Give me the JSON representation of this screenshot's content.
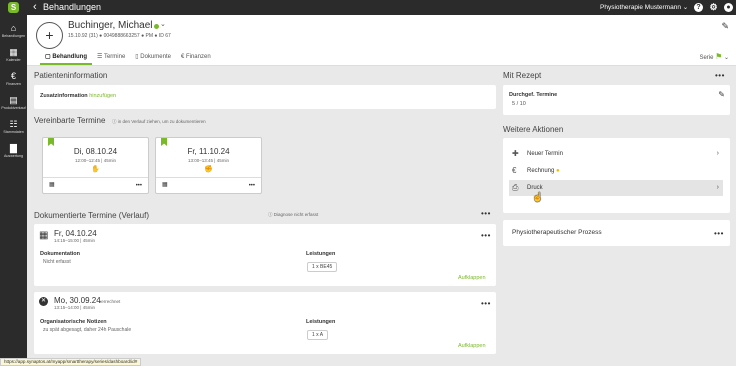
{
  "topbar": {
    "title": "Behandlungen",
    "practice": "Physiotherapie Mustermann",
    "help_icon": "help-icon",
    "settings_icon": "gear-icon",
    "user_icon": "user-icon"
  },
  "sidebar": {
    "items": [
      {
        "label": "Behandlungen",
        "icon": "home-icon"
      },
      {
        "label": "Kalender",
        "icon": "calendar-icon"
      },
      {
        "label": "Finanzen",
        "icon": "euro-icon"
      },
      {
        "label": "Produktverkauf",
        "icon": "product-icon"
      },
      {
        "label": "Stammdaten",
        "icon": "hierarchy-icon"
      },
      {
        "label": "Auswertung",
        "icon": "chart-icon"
      }
    ]
  },
  "patient": {
    "name": "Buchinger, Michael",
    "birth": "15.10.92 (31)",
    "phone": "0049888663257",
    "type": "PM",
    "id": "ID 67",
    "status_color": "#7ab929"
  },
  "tabs": [
    {
      "label": "Behandlung",
      "active": true
    },
    {
      "label": "Termine",
      "active": false
    },
    {
      "label": "Dokumente",
      "active": false
    },
    {
      "label": "Finanzen",
      "active": false
    }
  ],
  "serie_label": "Serie",
  "patient_info": {
    "title": "Patienteninformation",
    "zusatz_label": "Zusatzinformation",
    "zusatz_link": "hinzufügen"
  },
  "agreed": {
    "title": "Vereinbarte Termine",
    "hint": "in den Verlauf ziehen, um zu dokumentieren",
    "appointments": [
      {
        "date": "Di, 08.10.24",
        "time": "12:00–12:45 | 45min"
      },
      {
        "date": "Fr, 11.10.24",
        "time": "13:00–13:45 | 45min"
      }
    ]
  },
  "documented": {
    "title": "Dokumentierte Termine (Verlauf)",
    "hint": "Diagnose nicht erfasst",
    "entries": [
      {
        "date": "Fr, 04.10.24",
        "date_note": "",
        "time": "14:15–15:00 | 45min",
        "doc_label": "Dokumentation",
        "doc_value": "Nicht erfasst",
        "services_label": "Leistungen",
        "service": "1 x BE45",
        "expand": "Aufklappen"
      },
      {
        "date": "Mo, 30.09.24",
        "date_note": "verrechnet",
        "time": "13:15–14:00 | 45min",
        "doc_label": "Organisatorische Notizen",
        "doc_value": "zu spät abgesagt, daher 24h Pauschale",
        "services_label": "Leistungen",
        "service": "1 x A",
        "expand": "Aufklappen"
      }
    ]
  },
  "rezept": {
    "title": "Mit Rezept",
    "label": "Durchgef. Termine",
    "value": "5 / 10"
  },
  "actions": {
    "title": "Weitere Aktionen",
    "items": [
      {
        "label": "Neuer Termin",
        "icon": "plus-icon"
      },
      {
        "label": "Rechnung",
        "icon": "euro-icon"
      },
      {
        "label": "Druck",
        "icon": "printer-icon"
      }
    ]
  },
  "process": {
    "title": "Physiotherapeutischer Prozess"
  },
  "status_url": "https://app.synaptos.at/myapp/smarttherapy/series/dashboard/id#"
}
